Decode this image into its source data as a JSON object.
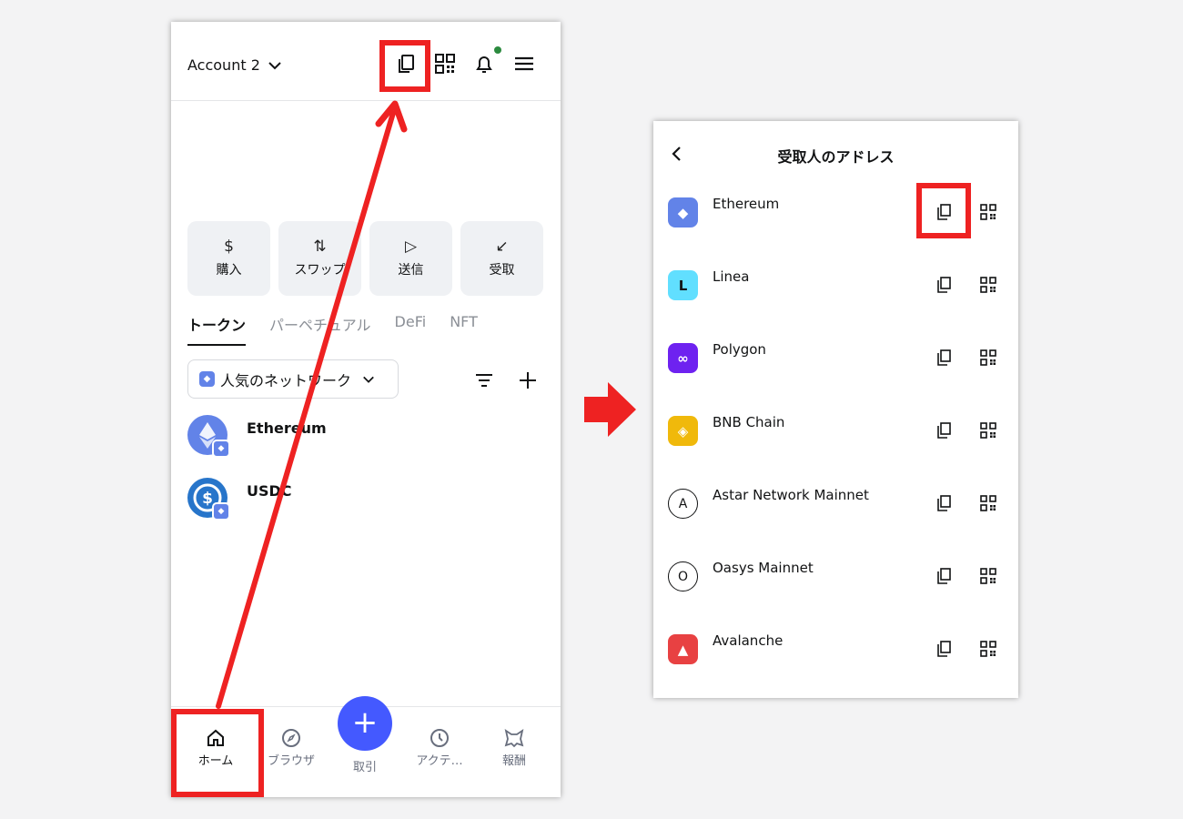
{
  "left": {
    "account": "Account 2",
    "actions": [
      {
        "icon": "$",
        "label": "購入"
      },
      {
        "icon": "⇅",
        "label": "スワップ"
      },
      {
        "icon": "▷",
        "label": "送信"
      },
      {
        "icon": "↙",
        "label": "受取"
      }
    ],
    "tabs": [
      "トークン",
      "パーペチュアル",
      "DeFi",
      "NFT"
    ],
    "network_select": "人気のネットワーク",
    "tokens": [
      {
        "name": "Ethereum",
        "color": "#6283e8"
      },
      {
        "name": "USDC",
        "color": "#2775ca"
      }
    ],
    "nav": {
      "home": "ホーム",
      "browser": "ブラウザ",
      "trade": "取引",
      "activity": "アクテ…",
      "rewards": "報酬"
    }
  },
  "right": {
    "title": "受取人のアドレス",
    "networks": [
      {
        "name": "Ethereum",
        "icon": "ethereum-icon",
        "color": "#6283e8"
      },
      {
        "name": "Linea",
        "icon": "linea-icon",
        "color": "#61dfff"
      },
      {
        "name": "Polygon",
        "icon": "polygon-icon",
        "color": "#6e22f0"
      },
      {
        "name": "BNB Chain",
        "icon": "bnb-icon",
        "color": "#f0b90b"
      },
      {
        "name": "Astar Network Mainnet",
        "icon": "A",
        "color": "#ffffff"
      },
      {
        "name": "Oasys Mainnet",
        "icon": "O",
        "color": "#ffffff"
      },
      {
        "name": "Avalanche",
        "icon": "avalanche-icon",
        "color": "#e84142"
      }
    ]
  },
  "colors": {
    "highlight": "#ee2222",
    "accent": "#4459ff"
  }
}
